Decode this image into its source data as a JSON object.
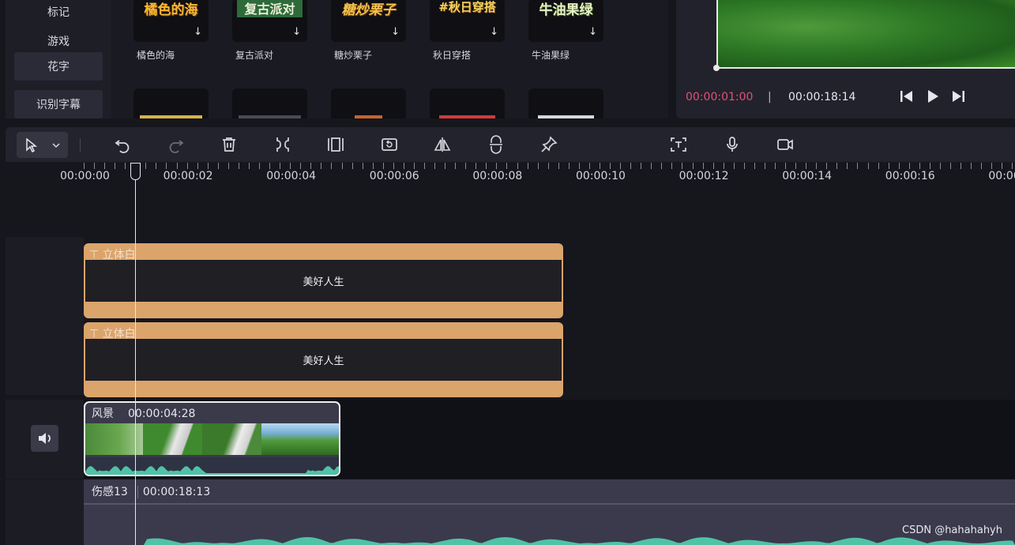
{
  "sidebar": {
    "items": [
      {
        "label": "标记"
      },
      {
        "label": "游戏"
      },
      {
        "label": "花字",
        "active": true
      },
      {
        "label": "识别字幕"
      }
    ]
  },
  "effects": {
    "row1": [
      {
        "title": "橘色的海",
        "label": "橘色的海"
      },
      {
        "title": "复古派对",
        "label": "复古派对"
      },
      {
        "title": "糖炒栗子",
        "label": "糖炒栗子"
      },
      {
        "title": "#秋日穿搭",
        "label": "秋日穿搭"
      },
      {
        "title": "牛油果绿",
        "label": "牛油果绿"
      }
    ],
    "download_icon": "↓"
  },
  "preview": {
    "current_time": "00:00:01:00",
    "total_time": "00:00:18:14",
    "current_time_color": "#e0517a"
  },
  "toolbar": {
    "tools": [
      "select-cursor",
      "undo",
      "redo",
      "delete",
      "split",
      "crop",
      "rotate",
      "mirror",
      "freeze",
      "pin",
      "text-recognize",
      "microphone",
      "camera"
    ]
  },
  "ruler": {
    "labels": [
      "00:00:00",
      "00:00:02",
      "00:00:04",
      "00:00:06",
      "00:00:08",
      "00:00:10",
      "00:00:12",
      "00:00:14",
      "00:00:16",
      "00:00:1"
    ]
  },
  "tracks": {
    "text1": {
      "type": "立体白",
      "content": "美好人生"
    },
    "text2": {
      "type": "立体白",
      "content": "美好人生"
    },
    "video": {
      "name": "风景",
      "duration": "00:00:04:28"
    },
    "audio": {
      "name": "伤感13",
      "duration": "00:00:18:13"
    }
  },
  "watermark": "CSDN @hahahahyh",
  "colors": {
    "text_clip": "#dba46b",
    "waveform": "#4fc3a6",
    "accent_time": "#e0517a"
  }
}
